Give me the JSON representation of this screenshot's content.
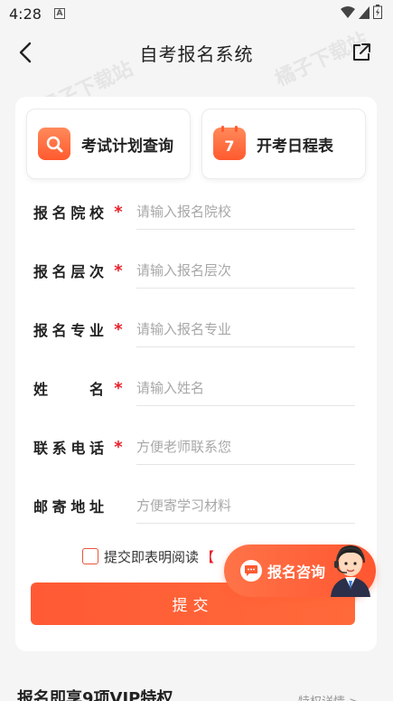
{
  "status_bar": {
    "time": "4:28",
    "notification_letter": "A"
  },
  "nav": {
    "title": "自考报名系统"
  },
  "quick_actions": [
    {
      "label": "考试计划查询",
      "icon": "search-icon"
    },
    {
      "label": "开考日程表",
      "icon": "calendar-icon",
      "badge": "7"
    }
  ],
  "form": {
    "fields": [
      {
        "label_chars": [
          "报",
          "名",
          "院",
          "校"
        ],
        "required": "*",
        "placeholder": "请输入报名院校"
      },
      {
        "label_chars": [
          "报",
          "名",
          "层",
          "次"
        ],
        "required": "*",
        "placeholder": "请输入报名层次"
      },
      {
        "label_chars": [
          "报",
          "名",
          "专",
          "业"
        ],
        "required": "*",
        "placeholder": "请输入报名专业"
      },
      {
        "label_chars": [
          "姓",
          "名"
        ],
        "required": "*",
        "placeholder": "请输入姓名"
      },
      {
        "label_chars": [
          "联",
          "系",
          "电",
          "话"
        ],
        "required": "*",
        "placeholder": "方便老师联系您"
      },
      {
        "label_chars": [
          "邮",
          "寄",
          "地",
          "址"
        ],
        "required": "",
        "placeholder": "方便寄学习材料"
      }
    ],
    "agree_text": "提交即表明阅读",
    "agree_link": "【",
    "submit_label": "提交"
  },
  "consult": {
    "label": "报名咨询"
  },
  "vip": {
    "title": "报名即享9项VIP特权",
    "link": "特权详情 >"
  },
  "watermark": "橘子下载站",
  "colors": {
    "accent": "#ff5a35",
    "required": "#e8202a"
  }
}
